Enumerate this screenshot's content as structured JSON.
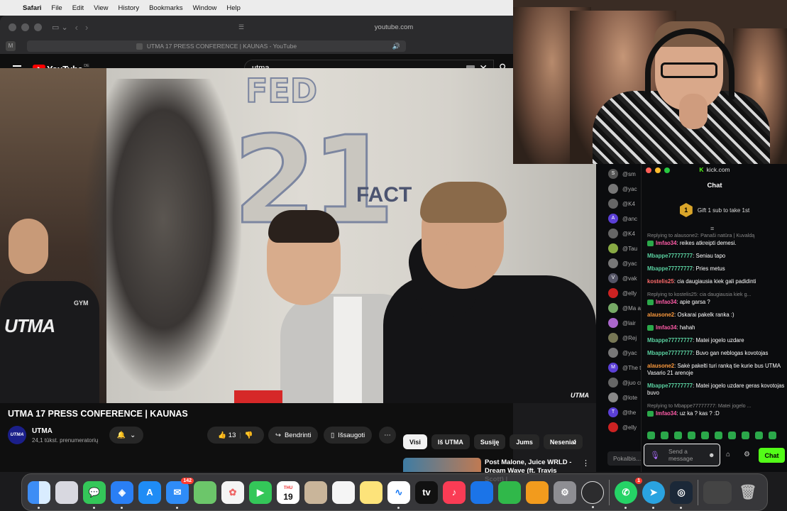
{
  "menubar": {
    "app": "Safari",
    "items": [
      "File",
      "Edit",
      "View",
      "History",
      "Bookmarks",
      "Window",
      "Help"
    ]
  },
  "safari": {
    "url": "youtube.com",
    "tab_title": "UTMA 17 PRESS CONFERENCE | KAUNAS - YouTube",
    "tab_favicon": "M"
  },
  "youtube": {
    "logo": "YouTube",
    "country": "DE",
    "search_value": "utma",
    "video_title": "UTMA 17 PRESS CONFERENCE | KAUNAS",
    "video_overlay": {
      "wall_text_1": "FED",
      "wall_text_2": "21",
      "wall_text_3": "FACT",
      "shirt_text": "UTMA",
      "shirt_logo": "GYM",
      "watermark": "UTMA"
    },
    "channel": {
      "avatar_text": "UTMA",
      "name": "UTMA",
      "subscribers": "24,1 tūkst. prenumeratorių"
    },
    "likes": "13",
    "share_label": "Bendrinti",
    "save_label": "Išsaugoti",
    "chips": [
      "Visi",
      "Iš UTMA",
      "Susiję",
      "Jums",
      "Neseniai"
    ],
    "up_next_title": "Post Malone, Juice WRLD - Dream Wave (ft. Travis Scott) |"
  },
  "kick": {
    "url": "kick.com",
    "title": "Chat",
    "gift_rank": "1",
    "gift_text": "Gift 1 sub to take 1st",
    "messages": [
      {
        "reply": "Replying to alausone2: Panaši natūra | Kuvaldą",
        "user": "lmfao34",
        "color": "#ff5ca8",
        "badge": true,
        "text": "reikes atkreipti demesi."
      },
      {
        "reply": "",
        "user": "Mbappe77777777",
        "color": "#5ad1a0",
        "badge": false,
        "text": "Seniau tapo"
      },
      {
        "reply": "",
        "user": "Mbappe77777777",
        "color": "#5ad1a0",
        "badge": false,
        "text": "Pries metus"
      },
      {
        "reply": "",
        "user": "kostelis25",
        "color": "#ff6b6b",
        "badge": false,
        "text": "cia daugiausia kiek gali padidinti"
      },
      {
        "reply": "Replying to kostelis25: cia daugiausia kiek g...",
        "user": "lmfao34",
        "color": "#ff5ca8",
        "badge": true,
        "text": "apie garsa ?"
      },
      {
        "reply": "",
        "user": "alausone2",
        "color": "#ff9b3d",
        "badge": false,
        "text": "Oskarai pakelk ranka :)"
      },
      {
        "reply": "",
        "user": "lmfao34",
        "color": "#ff5ca8",
        "badge": true,
        "text": "hahah"
      },
      {
        "reply": "",
        "user": "Mbappe77777777",
        "color": "#5ad1a0",
        "badge": false,
        "text": "Matei jogelo uzdare"
      },
      {
        "reply": "",
        "user": "Mbappe77777777",
        "color": "#5ad1a0",
        "badge": false,
        "text": "Buvo gan neblogas kovotojas"
      },
      {
        "reply": "",
        "user": "alausone2",
        "color": "#ff9b3d",
        "badge": false,
        "text": "Sakė pakelti turi ranką tie kurie bus UTMA Vasario 21 arenoje"
      },
      {
        "reply": "",
        "user": "Mbappe77777777",
        "color": "#5ad1a0",
        "badge": false,
        "text": "Matei jogelo uzdare geras kovotojas buvo"
      },
      {
        "reply": "Replying to Mbappe77777777: Matei jogelo ...",
        "user": "lmfao34",
        "color": "#ff5ca8",
        "badge": true,
        "text": "uz ka ? kas ? :D"
      }
    ],
    "input_placeholder": "Send a message",
    "send_label": "Chat"
  },
  "kick_strip": [
    {
      "av": "S",
      "color": "#555",
      "name": "@sm"
    },
    {
      "av": "",
      "color": "#777",
      "name": "@yac"
    },
    {
      "av": "",
      "color": "#666",
      "name": "@K4"
    },
    {
      "av": "A",
      "color": "#5b3fd6",
      "name": "@anc"
    },
    {
      "av": "",
      "color": "#666",
      "name": "@K4"
    },
    {
      "av": "",
      "color": "#8a4",
      "name": "@Tau"
    },
    {
      "av": "",
      "color": "#777",
      "name": "@yac"
    },
    {
      "av": "V",
      "color": "#556",
      "name": "@vak"
    },
    {
      "av": "",
      "color": "#c22",
      "name": "@elly"
    },
    {
      "av": "",
      "color": "#7a6",
      "name": "@Ma adek"
    },
    {
      "av": "",
      "color": "#a6c",
      "name": "@lair"
    },
    {
      "av": "",
      "color": "#775",
      "name": "@Rej"
    },
    {
      "av": "",
      "color": "#777",
      "name": "@yac"
    },
    {
      "av": "M",
      "color": "#5b3fd6",
      "name": "@The tokia"
    },
    {
      "av": "",
      "color": "#666",
      "name": "@juo cring"
    },
    {
      "av": "",
      "color": "#888",
      "name": "@lote"
    },
    {
      "av": "T",
      "color": "#5b3fd6",
      "name": "@the"
    },
    {
      "av": "",
      "color": "#c22",
      "name": "@elly"
    }
  ],
  "kick_strip_input": "Pokalbis...",
  "dock": {
    "calendar_month": "THU",
    "calendar_day": "19",
    "mail_badge": "142",
    "whatsapp_badge": "1",
    "apps": [
      "finder-icon",
      "launchpad-icon",
      "messages-icon",
      "safari-icon",
      "appstore-icon",
      "mail-icon",
      "maps-icon",
      "photos-icon",
      "facetime-icon",
      "calendar-icon",
      "contacts-icon",
      "reminders-icon",
      "notes-icon",
      "freeform-icon",
      "tv-icon",
      "music-icon",
      "keynote-icon",
      "numbers-icon",
      "pages-icon",
      "settings-icon",
      "obs-icon",
      "whatsapp-icon",
      "telegram-icon",
      "steam-icon"
    ]
  }
}
